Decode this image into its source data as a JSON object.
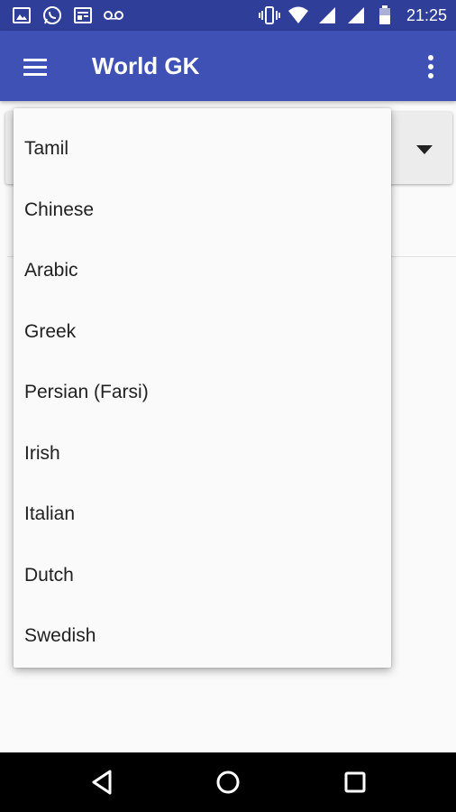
{
  "status_bar": {
    "time": "21:25",
    "icons": [
      "gallery-icon",
      "whatsapp-icon",
      "news-icon",
      "voicemail-icon",
      "vibrate-icon",
      "wifi-icon",
      "signal-icon",
      "signal-icon",
      "battery-icon"
    ]
  },
  "app_bar": {
    "title": "World GK",
    "icons": [
      "hamburger-menu-icon",
      "overflow-menu-icon"
    ]
  },
  "dropdown": {
    "items": [
      "Tamil",
      "Chinese",
      "Arabic",
      "Greek",
      "Persian (Farsi)",
      "Irish",
      "Italian",
      "Dutch",
      "Swedish"
    ]
  },
  "nav_bar": {
    "icons": [
      "back-icon",
      "home-icon",
      "recents-icon"
    ]
  },
  "colors": {
    "status_bar": "#2f3e98",
    "app_bar": "#3f51b5",
    "background": "#fafafa",
    "nav_bar": "#000000"
  }
}
